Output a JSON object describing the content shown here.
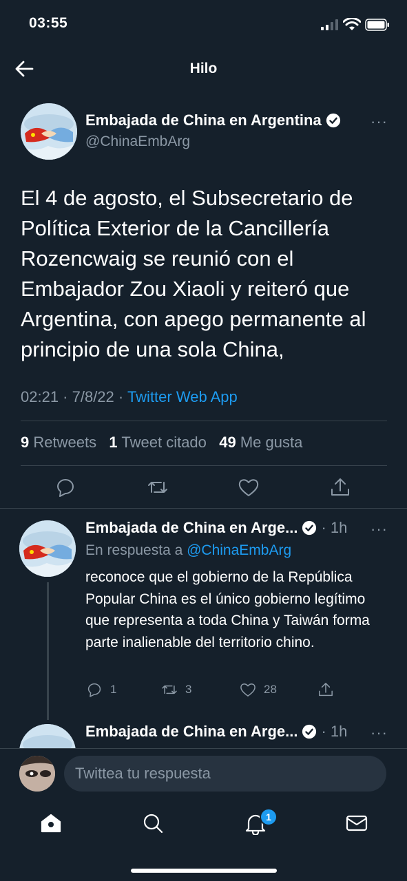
{
  "status": {
    "time": "03:55"
  },
  "header": {
    "title": "Hilo"
  },
  "main_tweet": {
    "name": "Embajada de China en Argentina",
    "handle": "@ChinaEmbArg",
    "text": "El 4 de agosto, el Subsecretario de Política Exterior de la Cancillería Rozencwaig se reunió con el Embajador Zou Xiaoli y reiteró que Argentina, con apego permanente al principio de una sola China,",
    "time": "02:21 · 7/8/22 · ",
    "source": "Twitter Web App",
    "retweets_count": "9",
    "retweets_label": " Retweets",
    "quotes_count": "1",
    "quotes_label": " Tweet citado",
    "likes_count": "49",
    "likes_label": " Me gusta",
    "more": "···"
  },
  "reply_tweet": {
    "name": "Embajada de China en Arge...",
    "time": "· 1h",
    "reply_prefix": "En respuesta a ",
    "reply_handle": "@ChinaEmbArg",
    "text": "reconoce que el gobierno de la República Popular China es el único gobierno legítimo que representa a toda China y Taiwán forma parte inalienable del territorio chino.",
    "replies": "1",
    "retweets": "3",
    "likes": "28",
    "more": "···"
  },
  "next_tweet": {
    "name": "Embajada de China en Arge...",
    "time": "· 1h",
    "more": "···"
  },
  "compose": {
    "placeholder": "Twittea tu respuesta"
  },
  "tabbar": {
    "notifications_badge": "1"
  },
  "colors": {
    "background": "#15202b",
    "accent": "#1d9bf0",
    "muted": "#8b98a5",
    "divider": "#38444d"
  }
}
